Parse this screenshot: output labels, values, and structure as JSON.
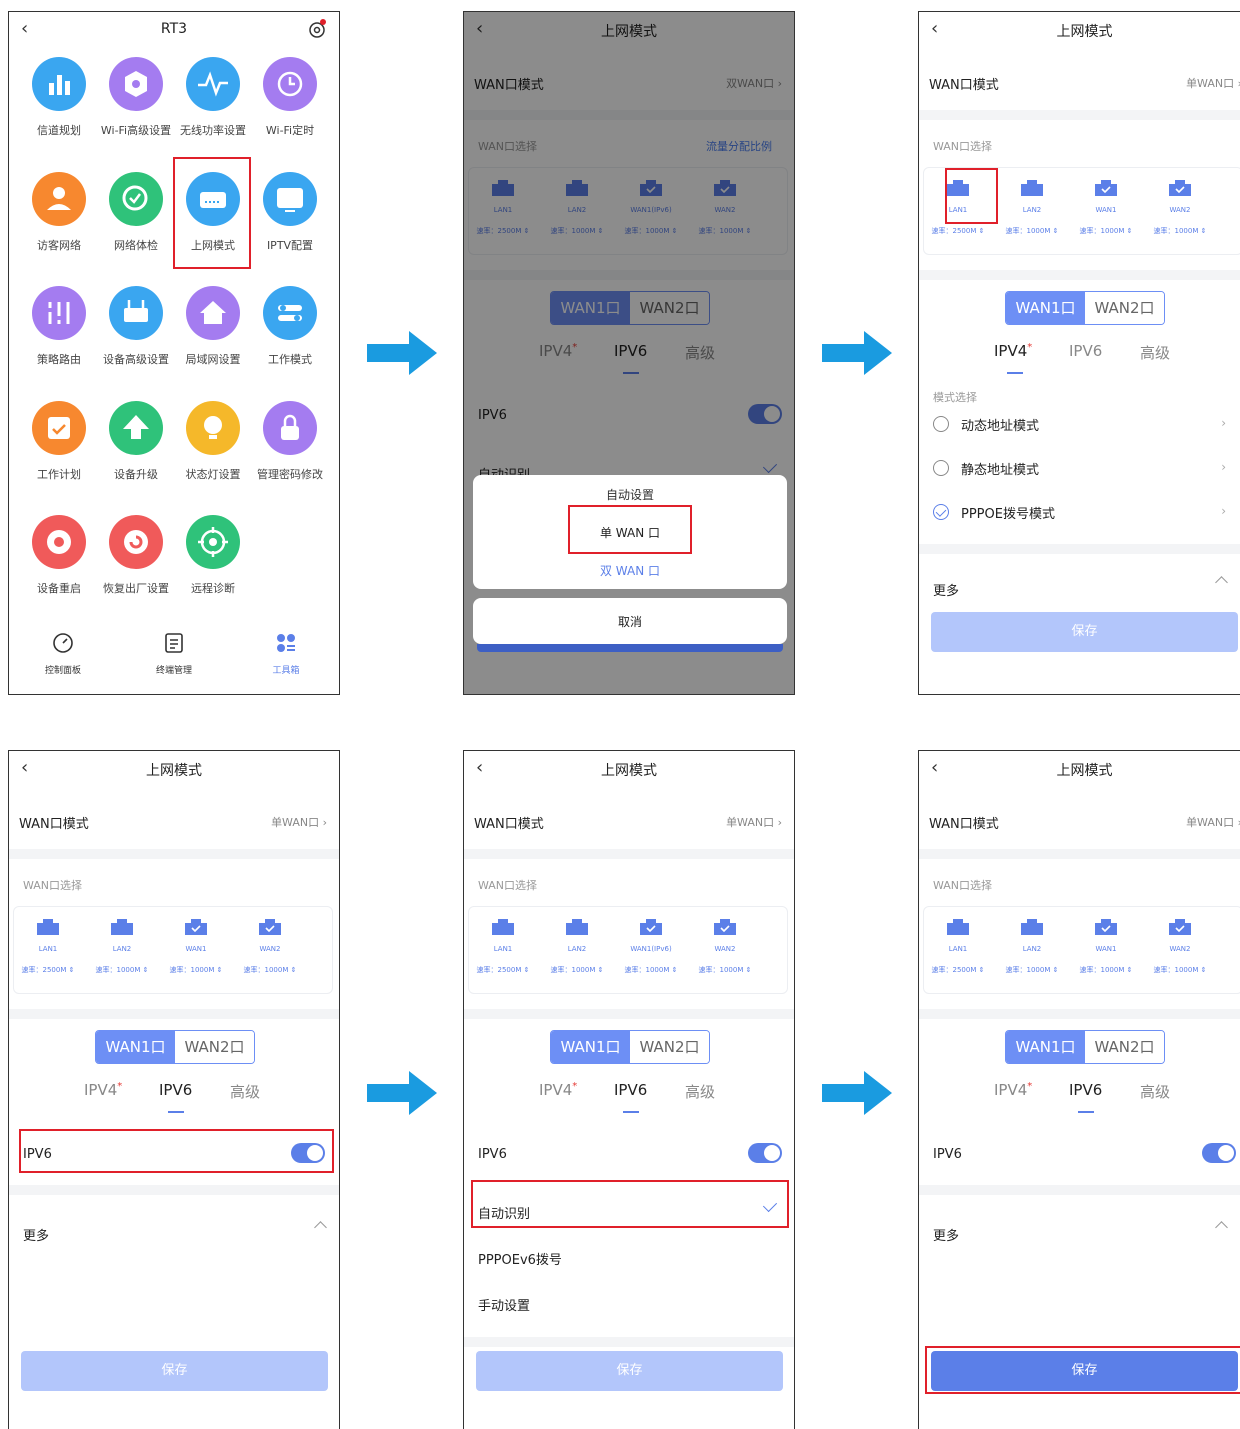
{
  "tools_screen": {
    "title": "RT3",
    "tools": [
      {
        "label": "信道规划",
        "icon": "bar-chart-icon",
        "color": "#3aa6f0"
      },
      {
        "label": "Wi-Fi高级设置",
        "icon": "hexagon-icon",
        "color": "#a47cf0"
      },
      {
        "label": "无线功率设置",
        "icon": "pulse-icon",
        "color": "#3aa6f0"
      },
      {
        "label": "Wi-Fi定时",
        "icon": "clock-icon",
        "color": "#a47cf0"
      },
      {
        "label": "访客网络",
        "icon": "guest-icon",
        "color": "#f7882f"
      },
      {
        "label": "网络体检",
        "icon": "check-scan-icon",
        "color": "#2fc27a"
      },
      {
        "label": "上网模式",
        "icon": "router-icon",
        "color": "#3aa6f0"
      },
      {
        "label": "IPTV配置",
        "icon": "tv-icon",
        "color": "#3aa6f0"
      },
      {
        "label": "策略路由",
        "icon": "sliders-icon",
        "color": "#a47cf0"
      },
      {
        "label": "设备高级设置",
        "icon": "device-icon",
        "color": "#3aa6f0"
      },
      {
        "label": "局域网设置",
        "icon": "home-icon",
        "color": "#a47cf0"
      },
      {
        "label": "工作模式",
        "icon": "switch-icon",
        "color": "#3aa6f0"
      },
      {
        "label": "工作计划",
        "icon": "calendar-icon",
        "color": "#f7882f"
      },
      {
        "label": "设备升级",
        "icon": "upload-icon",
        "color": "#2fc27a"
      },
      {
        "label": "状态灯设置",
        "icon": "bulb-icon",
        "color": "#f5b82a"
      },
      {
        "label": "管理密码修改",
        "icon": "lock-icon",
        "color": "#a47cf0"
      },
      {
        "label": "设备重启",
        "icon": "power-icon",
        "color": "#f05a5a"
      },
      {
        "label": "恢复出厂设置",
        "icon": "reset-icon",
        "color": "#f05a5a"
      },
      {
        "label": "远程诊断",
        "icon": "target-icon",
        "color": "#2fc27a"
      }
    ],
    "tabs": [
      {
        "label": "控制面板",
        "icon": "dashboard-icon"
      },
      {
        "label": "终端管理",
        "icon": "list-icon"
      },
      {
        "label": "工具箱",
        "icon": "toolbox-icon"
      }
    ]
  },
  "mode_screen": {
    "title": "上网模式",
    "wan_mode_label": "WAN口模式",
    "wan_mode_dual": "双WAN口",
    "wan_mode_single": "单WAN口",
    "wan_select_label": "WAN口选择",
    "ratio_link": "流量分配比例",
    "ports_a": [
      {
        "name": "LAN1",
        "speed": "速率：2500M"
      },
      {
        "name": "LAN2",
        "speed": "速率：1000M"
      },
      {
        "name": "WAN1(IPv6)",
        "speed": "速率：1000M"
      },
      {
        "name": "WAN2",
        "speed": "速率：1000M"
      }
    ],
    "ports_b": [
      {
        "name": "LAN1",
        "speed": "速率：2500M"
      },
      {
        "name": "LAN2",
        "speed": "速率：1000M"
      },
      {
        "name": "WAN1",
        "speed": "速率：1000M"
      },
      {
        "name": "WAN2",
        "speed": "速率：1000M"
      }
    ],
    "seg": [
      "WAN1口",
      "WAN2口"
    ],
    "subtabs": [
      "IPV4",
      "IPV6",
      "高级"
    ],
    "required_mark": "*",
    "ipv6_label": "IPV6",
    "auto_detect": "自动识别",
    "pppoev6": "PPPOEv6拨号",
    "manual": "手动设置",
    "mode_select": "模式选择",
    "dynamic": "动态地址模式",
    "static": "静态地址模式",
    "pppoe": "PPPOE拨号模式",
    "more": "更多",
    "save": "保存",
    "chevron": "›"
  },
  "action_sheet": {
    "title": "自动设置",
    "single": "单 WAN 口",
    "dual": "双 WAN 口",
    "cancel": "取消"
  },
  "colors": {
    "accent": "#5b7fe8",
    "highlight": "#e0202a",
    "arrow": "#1a9be0"
  }
}
